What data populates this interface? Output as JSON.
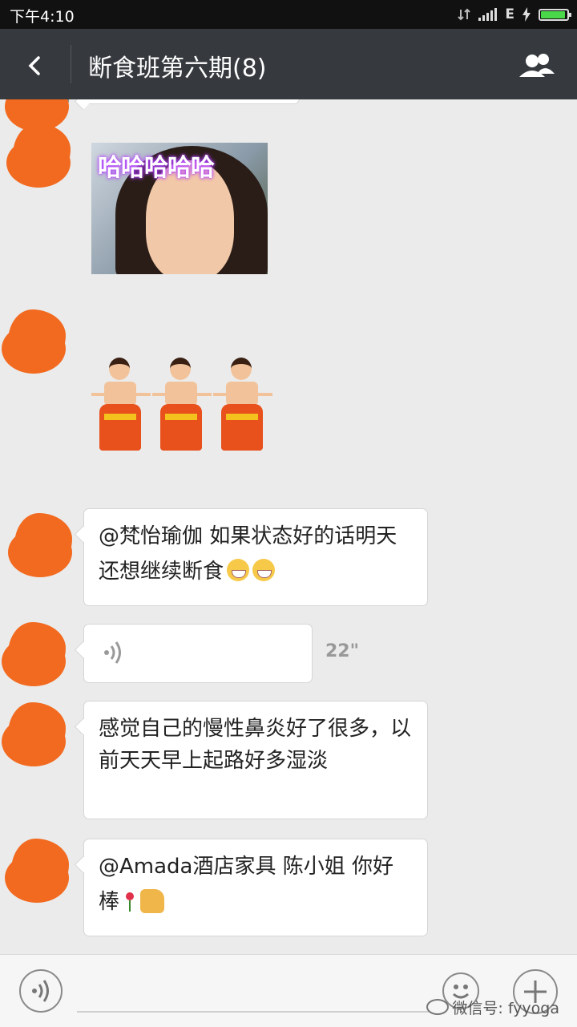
{
  "status_bar": {
    "time": "下午4:10",
    "network": "E"
  },
  "header": {
    "title": "断食班第六期(8)"
  },
  "messages": [
    {
      "type": "image",
      "caption": "哈哈哈哈哈"
    },
    {
      "type": "sticker"
    },
    {
      "type": "text",
      "text": "@梵怡瑜伽 如果状态好的话明天还想继续断食"
    },
    {
      "type": "voice",
      "duration": "22\""
    },
    {
      "type": "text",
      "text": "感觉自己的慢性鼻炎好了很多，以前天天早上起路好多湿淡"
    },
    {
      "type": "text",
      "text": "@Amada酒店家具   陈小姐 你好棒"
    }
  ],
  "footer": {
    "watermark": "微信号: fyyoga"
  }
}
